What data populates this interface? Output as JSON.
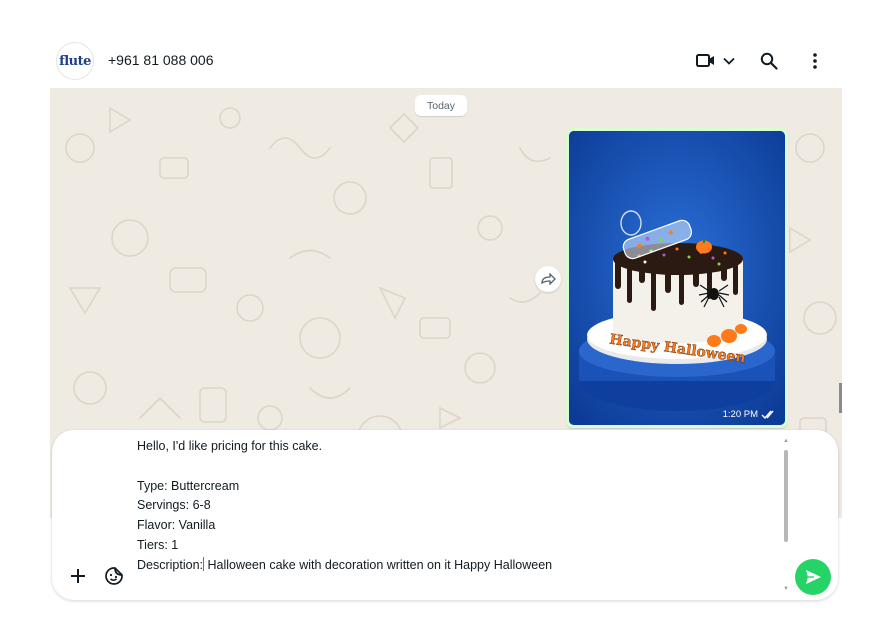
{
  "header": {
    "avatar_text": "flute",
    "contact_name": "+961 81 088 006",
    "icons": {
      "video": "video-camera-icon",
      "dropdown": "chevron-down-icon",
      "search": "search-icon",
      "menu": "kebab-menu-icon"
    }
  },
  "chat": {
    "date_chip": "Today",
    "forward_icon": "forward-icon",
    "message": {
      "image_caption_text": "Happy Halloween",
      "time": "1:20 PM",
      "status_icon": "double-check-icon"
    }
  },
  "composer": {
    "lines": [
      "Hello, I'd like pricing for this cake.",
      "",
      "Type: Buttercream",
      "Servings: 6-8",
      "Flavor: Vanilla",
      "Tiers: 1"
    ],
    "last_line_before_caret": "Description:",
    "last_line_after_caret": " Halloween cake with decoration written on it Happy Halloween",
    "icons": {
      "attach": "plus-icon",
      "sticker": "sticker-icon",
      "send": "send-icon"
    }
  },
  "colors": {
    "chat_bg": "#efeae2",
    "outgoing_bubble": "#d9fdd3",
    "send_button": "#25d366",
    "text_primary": "#111b21",
    "text_secondary": "#54656f"
  }
}
